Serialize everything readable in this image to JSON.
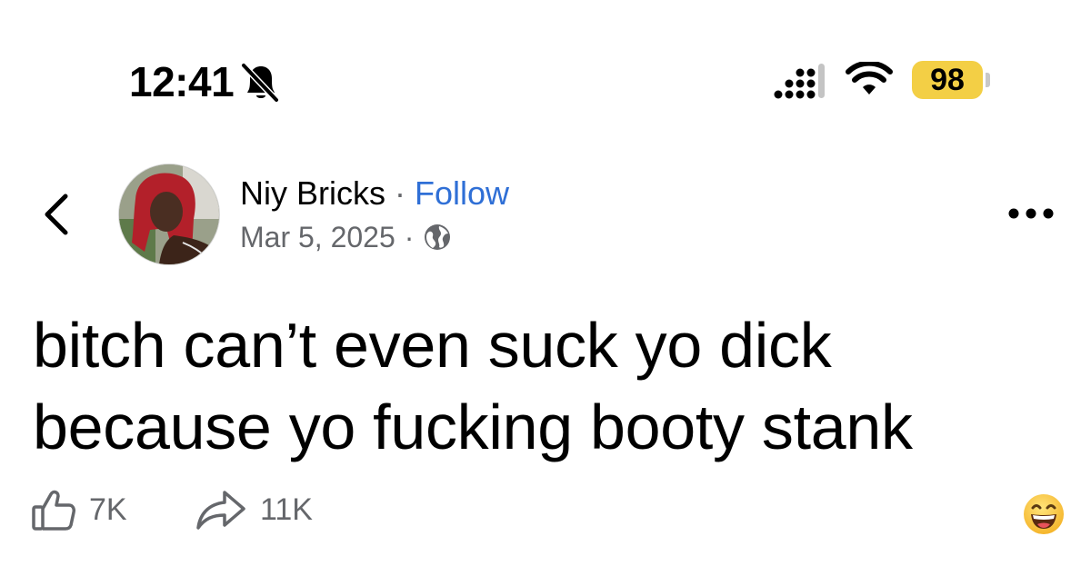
{
  "status_bar": {
    "time": "12:41",
    "battery": "98",
    "icons": [
      "bell-slash-icon",
      "cellular-signal-icon",
      "wifi-icon",
      "battery-icon"
    ],
    "battery_color": "#f3cf45"
  },
  "post": {
    "author": "Niy Bricks",
    "separator": "·",
    "follow_label": "Follow",
    "date": "Mar 5, 2025",
    "date_separator": "·",
    "visibility_icon": "globe-icon",
    "text": "bitch can’t even suck yo dick because yo fucking booty stank",
    "likes": "7K",
    "shares": "11K",
    "reaction_icon": "grinning-face-emoji-icon"
  },
  "colors": {
    "follow_link": "#2f6fd6",
    "meta_text": "#65676b",
    "text": "#000000"
  }
}
